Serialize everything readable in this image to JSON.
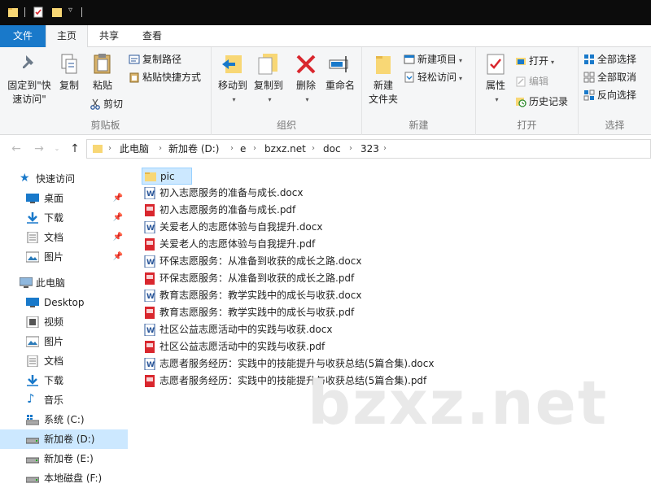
{
  "ribbon_tabs": [
    "文件",
    "主页",
    "共享",
    "查看"
  ],
  "ribbon": {
    "clipboard": {
      "label": "剪贴板",
      "pin_quick": "固定到\"快",
      "pin_quick2": "速访问\"",
      "copy": "复制",
      "paste": "粘贴",
      "copy_path": "复制路径",
      "paste_shortcut": "粘贴快捷方式",
      "cut": "剪切"
    },
    "organize": {
      "label": "组织",
      "move_to": "移动到",
      "copy_to": "复制到",
      "delete": "删除",
      "rename": "重命名"
    },
    "new": {
      "label": "新建",
      "new_folder": "新建",
      "new_folder2": "文件夹",
      "new_item": "新建项目",
      "easy_access": "轻松访问"
    },
    "open": {
      "label": "打开",
      "properties": "属性",
      "open": "打开",
      "edit": "编辑",
      "history": "历史记录"
    },
    "select": {
      "label": "选择",
      "select_all": "全部选择",
      "select_none": "全部取消",
      "invert": "反向选择"
    }
  },
  "breadcrumb": [
    "此电脑",
    "新加卷 (D:)",
    "e",
    "bzxz.net",
    "doc",
    "323"
  ],
  "nav_pane": {
    "quick_access": "快速访问",
    "quick_items": [
      "桌面",
      "下载",
      "文档",
      "图片"
    ],
    "this_pc": "此电脑",
    "pc_items": [
      "Desktop",
      "视频",
      "图片",
      "文档",
      "下载",
      "音乐",
      "系统 (C:)",
      "新加卷 (D:)",
      "新加卷 (E:)",
      "本地磁盘 (F:)"
    ]
  },
  "files": [
    {
      "name": "pic",
      "type": "folder"
    },
    {
      "name": "初入志愿服务的准备与成长.docx",
      "type": "docx"
    },
    {
      "name": "初入志愿服务的准备与成长.pdf",
      "type": "pdf"
    },
    {
      "name": "关爱老人的志愿体验与自我提升.docx",
      "type": "docx"
    },
    {
      "name": "关爱老人的志愿体验与自我提升.pdf",
      "type": "pdf"
    },
    {
      "name": "环保志愿服务：从准备到收获的成长之路.docx",
      "type": "docx"
    },
    {
      "name": "环保志愿服务：从准备到收获的成长之路.pdf",
      "type": "pdf"
    },
    {
      "name": "教育志愿服务：教学实践中的成长与收获.docx",
      "type": "docx"
    },
    {
      "name": "教育志愿服务：教学实践中的成长与收获.pdf",
      "type": "pdf"
    },
    {
      "name": "社区公益志愿活动中的实践与收获.docx",
      "type": "docx"
    },
    {
      "name": "社区公益志愿活动中的实践与收获.pdf",
      "type": "pdf"
    },
    {
      "name": "志愿者服务经历：实践中的技能提升与收获总结(5篇合集).docx",
      "type": "docx"
    },
    {
      "name": "志愿者服务经历：实践中的技能提升与收获总结(5篇合集).pdf",
      "type": "pdf"
    }
  ],
  "watermark": "bzxz.net",
  "colors": {
    "accent": "#1979ca",
    "selection": "#cce8ff",
    "folder": "#f8d775",
    "pdf": "#d9272e",
    "docx": "#2b579a"
  }
}
